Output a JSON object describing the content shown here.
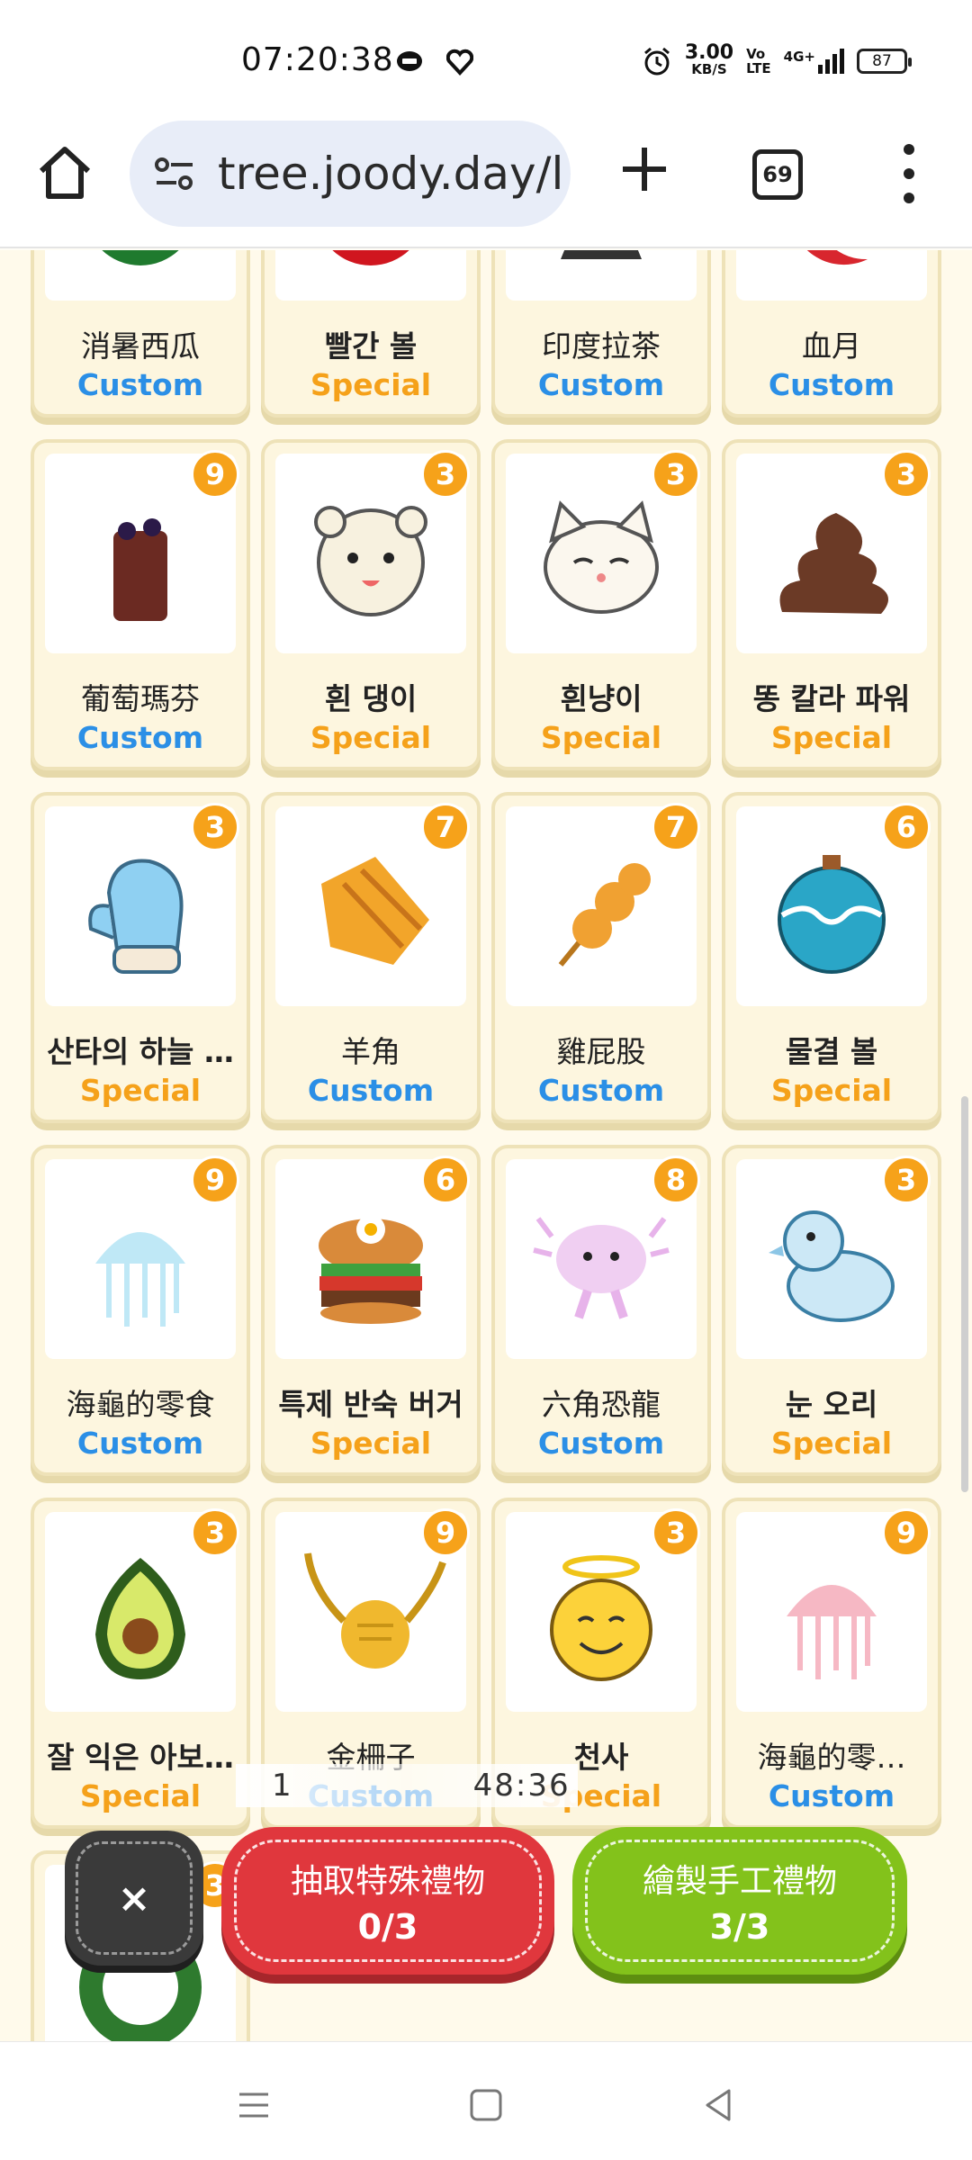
{
  "status_bar": {
    "time": "07:20:38",
    "speed_value": "3.00",
    "speed_unit": "KB/S",
    "volte_top": "Vo",
    "volte_bottom": "LTE",
    "network": "4G+",
    "battery": "87"
  },
  "browser": {
    "url": "tree.joody.day/l",
    "tab_count": "69"
  },
  "cards": [
    {
      "name": "消暑西瓜",
      "type": "Custom",
      "badge": "",
      "icon": "watermelon-icon",
      "bold": false
    },
    {
      "name": "빨간 볼",
      "type": "Special",
      "badge": "",
      "icon": "red-ornament-icon",
      "bold": true
    },
    {
      "name": "印度拉茶",
      "type": "Custom",
      "badge": "",
      "icon": "chai-tea-icon",
      "bold": false
    },
    {
      "name": "血月",
      "type": "Custom",
      "badge": "",
      "icon": "blood-moon-icon",
      "bold": false
    },
    {
      "name": "葡萄瑪芬",
      "type": "Custom",
      "badge": "9",
      "icon": "grape-muffin-icon",
      "bold": false
    },
    {
      "name": "흰 댕이",
      "type": "Special",
      "badge": "3",
      "icon": "white-puppy-icon",
      "bold": true
    },
    {
      "name": "흰냥이",
      "type": "Special",
      "badge": "3",
      "icon": "white-cat-icon",
      "bold": true
    },
    {
      "name": "똥 칼라 파워",
      "type": "Special",
      "badge": "3",
      "icon": "poop-icon",
      "bold": true
    },
    {
      "name": "산타의 하늘 …",
      "type": "Special",
      "badge": "3",
      "icon": "blue-mitten-icon",
      "bold": true
    },
    {
      "name": "羊角",
      "type": "Custom",
      "badge": "7",
      "icon": "croissant-icon",
      "bold": false
    },
    {
      "name": "雞屁股",
      "type": "Custom",
      "badge": "7",
      "icon": "chicken-skewer-icon",
      "bold": false
    },
    {
      "name": "물결 볼",
      "type": "Special",
      "badge": "6",
      "icon": "wave-ornament-icon",
      "bold": true
    },
    {
      "name": "海龜的零食",
      "type": "Custom",
      "badge": "9",
      "icon": "jellyfish-icon",
      "bold": false
    },
    {
      "name": "특제 반숙 버거",
      "type": "Special",
      "badge": "6",
      "icon": "burger-icon",
      "bold": true
    },
    {
      "name": "六角恐龍",
      "type": "Custom",
      "badge": "8",
      "icon": "axolotl-icon",
      "bold": false
    },
    {
      "name": "눈 오리",
      "type": "Special",
      "badge": "3",
      "icon": "snow-duck-icon",
      "bold": true
    },
    {
      "name": "잘 익은 아보…",
      "type": "Special",
      "badge": "3",
      "icon": "avocado-icon",
      "bold": true
    },
    {
      "name": "金柵子",
      "type": "Custom",
      "badge": "9",
      "icon": "golden-snitch-icon",
      "bold": false
    },
    {
      "name": "천사",
      "type": "Special",
      "badge": "3",
      "icon": "angel-emoji-icon",
      "bold": true
    },
    {
      "name": "海龜的零…",
      "type": "Custom",
      "badge": "9",
      "icon": "pink-jellyfish-icon",
      "bold": false
    },
    {
      "name": "",
      "type": "",
      "badge": "3",
      "icon": "wreath-icon",
      "bold": false
    }
  ],
  "overlay": {
    "time_left": "1",
    "time_right": "48:36"
  },
  "actions": {
    "close_label": "×",
    "draw_label": "抽取特殊禮物",
    "draw_count": "0/3",
    "craft_label": "繪製手工禮物",
    "craft_count": "3/3"
  },
  "colors": {
    "custom": "#2b8fe6",
    "special": "#f5a11a",
    "badge": "#f6a21a",
    "draw_button": "#e0373d",
    "craft_button": "#83c21b"
  }
}
